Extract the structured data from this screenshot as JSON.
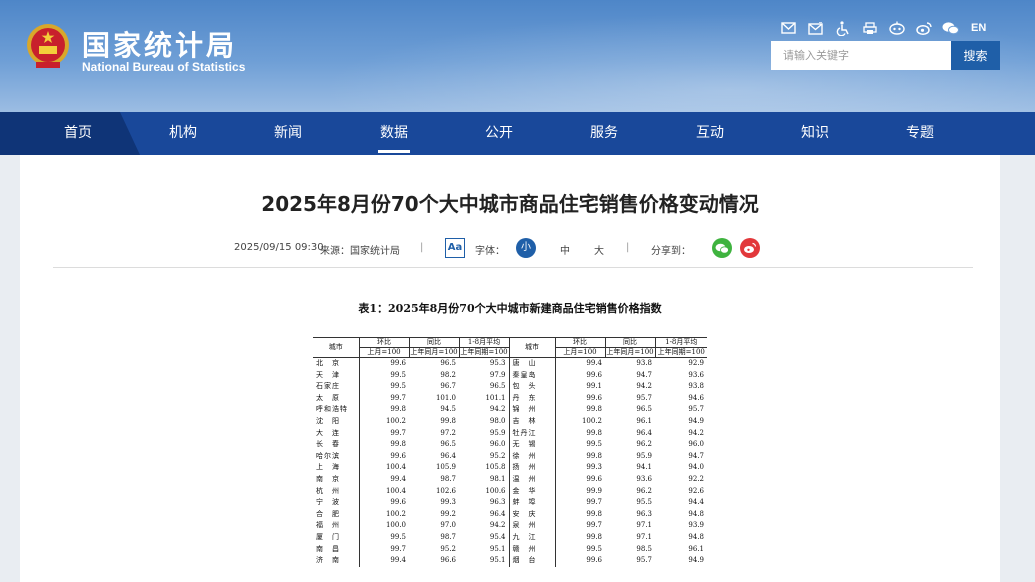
{
  "site": {
    "name_cn": "国家统计局",
    "name_en": "National Bureau of Statistics",
    "en_link": "EN",
    "search_placeholder": "请输入关键字",
    "search_button": "搜索",
    "toolbar_icons": [
      "mail-icon",
      "mailbox-icon",
      "accessibility-icon",
      "print-icon",
      "robot-icon",
      "weibo-icon",
      "wechat-icon"
    ]
  },
  "nav": {
    "items": [
      "首页",
      "机构",
      "新闻",
      "数据",
      "公开",
      "服务",
      "互动",
      "知识",
      "专题"
    ],
    "active": "数据"
  },
  "article": {
    "title": "2025年8月份70个大中城市商品住宅销售价格变动情况",
    "date": "2025/09/15 09:30",
    "source": "来源：国家统计局",
    "sep": "|",
    "aa": "Aa",
    "font_label": "字体：",
    "font_small": "小",
    "font_medium": "中",
    "font_large": "大",
    "share_label": "分享到："
  },
  "table": {
    "caption": "表1：2025年8月份70个大中城市新建商品住宅销售价格指数",
    "headers": {
      "city": "城市",
      "mom": "环比",
      "yoy": "同比",
      "avg": "1-8月平均",
      "mom_sub": "上月=100",
      "yoy_sub": "上年同月=100",
      "avg_sub": "上年同期=100"
    },
    "rows": [
      [
        "北　京",
        "99.6",
        "96.5",
        "95.3",
        "唐　山",
        "99.4",
        "93.8",
        "92.9"
      ],
      [
        "天　津",
        "99.5",
        "98.2",
        "97.9",
        "秦皇岛",
        "99.6",
        "94.7",
        "93.6"
      ],
      [
        "石家庄",
        "99.5",
        "96.7",
        "96.5",
        "包　头",
        "99.1",
        "94.2",
        "93.8"
      ],
      [
        "太　原",
        "99.7",
        "101.0",
        "101.1",
        "丹　东",
        "99.6",
        "95.7",
        "94.6"
      ],
      [
        "呼和浩特",
        "99.8",
        "94.5",
        "94.2",
        "锦　州",
        "99.8",
        "96.5",
        "95.7"
      ],
      [
        "沈　阳",
        "100.2",
        "99.8",
        "98.0",
        "吉　林",
        "100.2",
        "96.1",
        "94.9"
      ],
      [
        "大　连",
        "99.7",
        "97.2",
        "95.9",
        "牡丹江",
        "99.8",
        "96.4",
        "94.2"
      ],
      [
        "长　春",
        "99.8",
        "96.5",
        "96.0",
        "无　锡",
        "99.5",
        "96.2",
        "96.0"
      ],
      [
        "哈尔滨",
        "99.6",
        "96.4",
        "95.2",
        "徐　州",
        "99.8",
        "95.9",
        "94.7"
      ],
      [
        "上　海",
        "100.4",
        "105.9",
        "105.8",
        "扬　州",
        "99.3",
        "94.1",
        "94.0"
      ],
      [
        "南　京",
        "99.4",
        "98.7",
        "98.1",
        "温　州",
        "99.6",
        "93.6",
        "92.2"
      ],
      [
        "杭　州",
        "100.4",
        "102.6",
        "100.6",
        "金　华",
        "99.9",
        "96.2",
        "92.6"
      ],
      [
        "宁　波",
        "99.6",
        "99.3",
        "96.3",
        "蚌　埠",
        "99.7",
        "95.5",
        "94.4"
      ],
      [
        "合　肥",
        "100.2",
        "99.2",
        "96.4",
        "安　庆",
        "99.8",
        "96.3",
        "94.8"
      ],
      [
        "福　州",
        "100.0",
        "97.0",
        "94.2",
        "泉　州",
        "99.7",
        "97.1",
        "93.9"
      ],
      [
        "厦　门",
        "99.5",
        "98.7",
        "95.4",
        "九　江",
        "99.8",
        "97.1",
        "94.8"
      ],
      [
        "南　昌",
        "99.7",
        "95.2",
        "95.1",
        "赣　州",
        "99.5",
        "98.5",
        "96.1"
      ],
      [
        "济　南",
        "99.4",
        "96.6",
        "95.1",
        "烟　台",
        "99.6",
        "95.7",
        "94.9"
      ]
    ]
  },
  "colors": {
    "nav_bg": "#19489a",
    "accent": "#1f5fa8",
    "wechat": "#3fb33f",
    "weibo": "#e2383b"
  }
}
